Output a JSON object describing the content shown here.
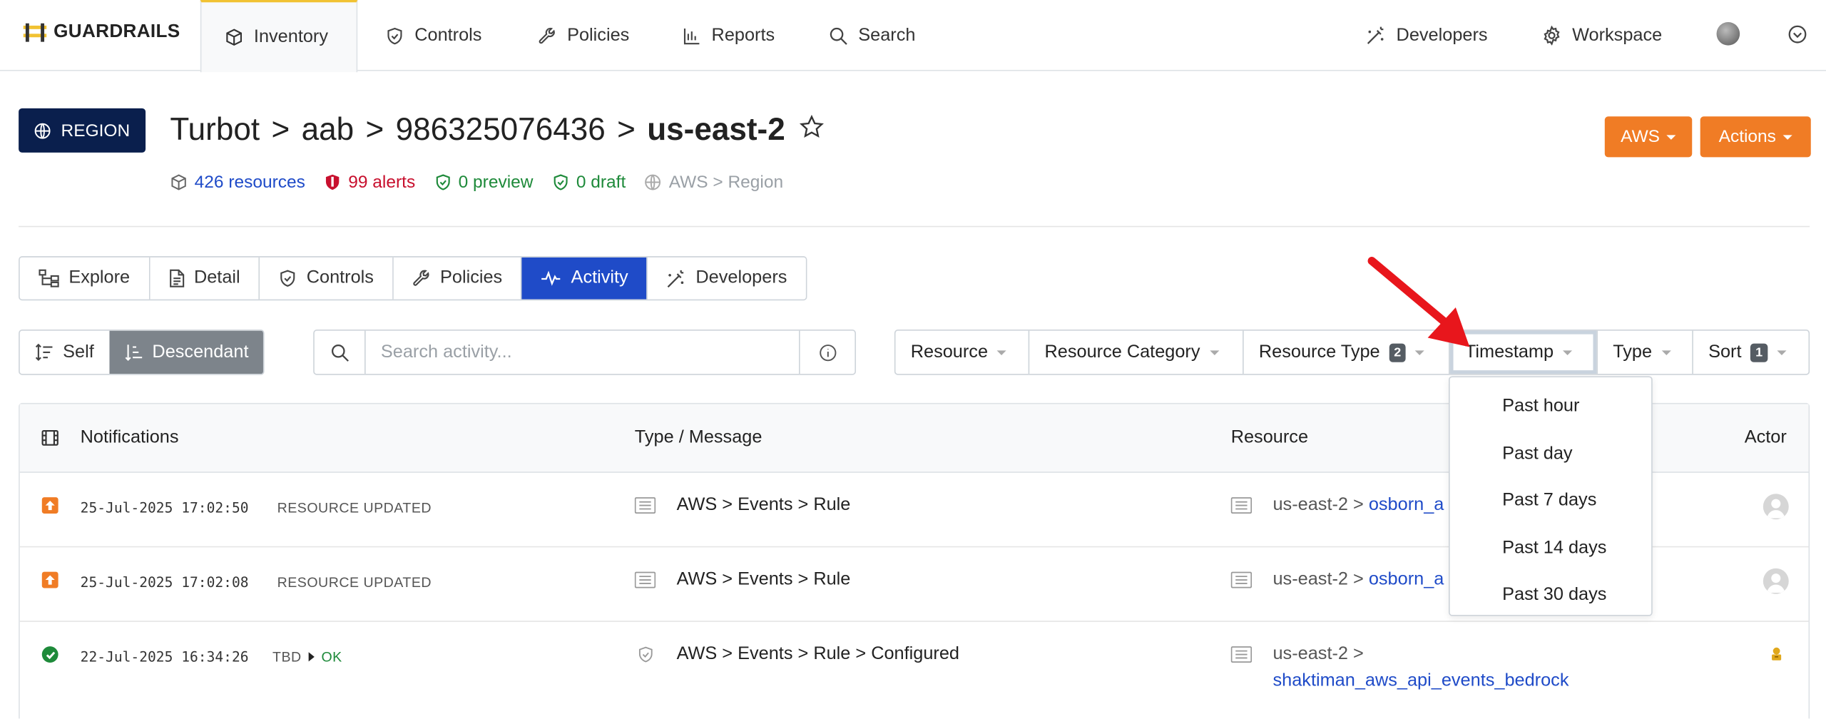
{
  "brand": {
    "name": "GUARDRAILS",
    "accent": "#f1c232"
  },
  "nav": {
    "items": [
      {
        "label": "Inventory",
        "icon": "cube-icon",
        "active": true
      },
      {
        "label": "Controls",
        "icon": "shield-check-icon"
      },
      {
        "label": "Policies",
        "icon": "wrench-icon"
      },
      {
        "label": "Reports",
        "icon": "chart-bar-icon"
      },
      {
        "label": "Search",
        "icon": "search-icon"
      }
    ],
    "right": [
      {
        "label": "Developers",
        "icon": "magic-wand-icon"
      },
      {
        "label": "Workspace",
        "icon": "gear-icon"
      }
    ]
  },
  "header": {
    "badge": "REGION",
    "crumbs": [
      "Turbot",
      ">",
      "aab",
      ">",
      "986325076436",
      ">"
    ],
    "current": "us-east-2",
    "stats": {
      "resources": "426 resources",
      "alerts": "99 alerts",
      "preview": "0 preview",
      "draft": "0 draft",
      "type": "AWS > Region"
    },
    "aws_button": "AWS",
    "actions_button": "Actions"
  },
  "tabs": [
    {
      "label": "Explore",
      "icon": "hierarchy-icon"
    },
    {
      "label": "Detail",
      "icon": "document-icon"
    },
    {
      "label": "Controls",
      "icon": "shield-check-icon"
    },
    {
      "label": "Policies",
      "icon": "wrench-icon"
    },
    {
      "label": "Activity",
      "icon": "pulse-icon",
      "active": true
    },
    {
      "label": "Developers",
      "icon": "magic-wand-icon"
    }
  ],
  "scope": {
    "self": "Self",
    "descendant": "Descendant",
    "active": "Descendant"
  },
  "search": {
    "placeholder": "Search activity..."
  },
  "filters": [
    {
      "label": "Resource"
    },
    {
      "label": "Resource Category"
    },
    {
      "label": "Resource Type",
      "count": "2"
    },
    {
      "label": "Timestamp",
      "open": true
    },
    {
      "label": "Type"
    },
    {
      "label": "Sort",
      "count": "1"
    }
  ],
  "timestamp_menu": [
    "Past hour",
    "Past day",
    "Past 7 days",
    "Past 14 days",
    "Past 30 days"
  ],
  "table": {
    "headers": {
      "notifications": "Notifications",
      "type": "Type / Message",
      "resource": "Resource",
      "actor": "Actor"
    },
    "rows": [
      {
        "status": "updated",
        "timestamp": "25-Jul-2025 17:02:50",
        "event": "RESOURCE UPDATED",
        "message": "AWS > Events > Rule",
        "res_prefix": "us-east-2 > ",
        "res_link": "osborn_a"
      },
      {
        "status": "updated",
        "timestamp": "25-Jul-2025 17:02:08",
        "event": "RESOURCE UPDATED",
        "message": "AWS > Events > Rule",
        "res_prefix": "us-east-2 > ",
        "res_link": "osborn_a"
      },
      {
        "status": "ok",
        "timestamp": "22-Jul-2025 16:34:26",
        "event": "TBD",
        "event_to": "OK",
        "message": "AWS > Events > Rule > Configured",
        "res_prefix": "us-east-2 >",
        "res_link": "shaktiman_aws_api_events_bedrock"
      }
    ]
  },
  "colors": {
    "primary": "#1f4bc8",
    "orange": "#f07c25",
    "navy": "#0a1f4d",
    "alert": "#c8102e",
    "green": "#1e8a3a"
  }
}
